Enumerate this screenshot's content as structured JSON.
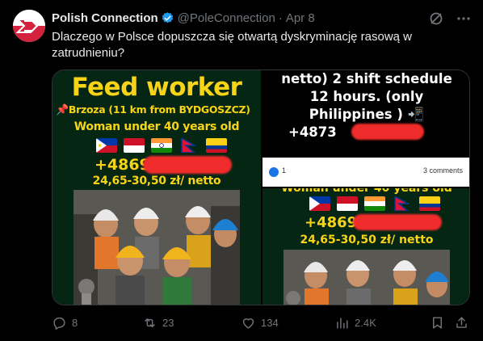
{
  "account": {
    "name": "Polish Connection",
    "handle": "@PoleConnection",
    "separator": "·",
    "date": "Apr 8"
  },
  "tweet": {
    "text": "Dlaczego w Polsce dopuszcza się otwartą dyskryminację rasową w zatrudnieniu?"
  },
  "media": {
    "left": {
      "title": "Feed worker",
      "location": "Brzoza (11 km from BYDGOSZCZ)",
      "requirement": "Woman under 40 years old",
      "flag_icons": [
        "philippines-flag-icon",
        "indonesia-flag-icon",
        "india-flag-icon",
        "nepal-flag-icon",
        "colombia-flag-icon"
      ],
      "phone_prefix": "+4869",
      "rate": "24,65-30,50 zł/ netto"
    },
    "right_top": {
      "line1": "netto) 2 shift schedule",
      "line2": "12 hours. (only",
      "line3": "Philippines )",
      "phone_prefix": "+4873",
      "like_count": "1",
      "comments": "3 comments"
    },
    "right_bottom": {
      "requirement": "Woman under 40 years old",
      "phone_prefix": "+4869",
      "rate": "24,65-30,50 zł/ netto"
    }
  },
  "actions": {
    "replies": "8",
    "reposts": "23",
    "likes": "134",
    "views": "2.4K"
  },
  "colors": {
    "background": "#000000",
    "text": "#e7e9ea",
    "muted": "#71767b",
    "verified": "#1d9bf0",
    "poster_yellow": "#f7d417",
    "poster_bg": "#062614",
    "redaction": "#ef2b2b"
  }
}
